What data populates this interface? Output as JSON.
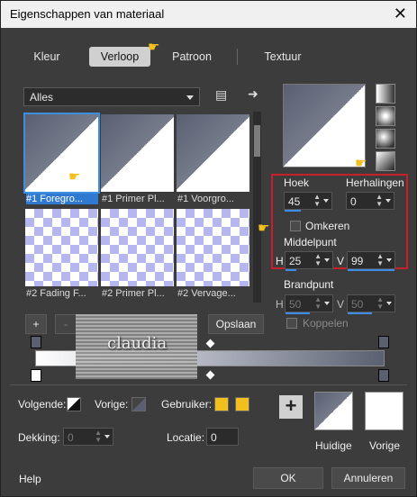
{
  "window": {
    "title": "Eigenschappen van materiaal",
    "close_glyph": "✕"
  },
  "tabs": [
    {
      "label": "Kleur"
    },
    {
      "label": "Verloop",
      "active": true
    },
    {
      "label": "Patroon"
    },
    {
      "label": "Textuur"
    }
  ],
  "category": {
    "selected": "Alles"
  },
  "thumbnails": [
    {
      "label": "#1 Foregro...",
      "style": "corner",
      "selected": true
    },
    {
      "label": "#1 Primer Pl...",
      "style": "corner"
    },
    {
      "label": "#1 Voorgro...",
      "style": "corner"
    },
    {
      "label": "#2 Fading F...",
      "style": "checker"
    },
    {
      "label": "#2 Primer Pl...",
      "style": "checker"
    },
    {
      "label": "#2 Vervage...",
      "style": "checker"
    }
  ],
  "gradient_settings": {
    "angle_label": "Hoek",
    "angle_value": "45",
    "repeats_label": "Herhalingen",
    "repeats_value": "0",
    "invert_label": "Omkeren",
    "center_label": "Middelpunt",
    "h_label": "H",
    "h_value": "25",
    "v_label": "V",
    "v_value": "99",
    "focal_label": "Brandpunt",
    "focal_h_value": "50",
    "focal_v_value": "50",
    "link_label": "Koppelen"
  },
  "editor": {
    "add_label": "+",
    "remove_label": "-",
    "save_label": "Opslaan",
    "watermark_text": "claudia"
  },
  "bottom": {
    "next_label": "Volgende:",
    "prev_label": "Vorige:",
    "user_label": "Gebruiker:",
    "user_color_1": "#f2c01e",
    "user_color_2": "#f2c01e",
    "opacity_label": "Dekking:",
    "opacity_value": "0",
    "location_label": "Locatie:",
    "location_value": "0",
    "plus_label": "+",
    "current_label": "Huidige",
    "previous_label": "Vorige"
  },
  "footer": {
    "help_label": "Help",
    "ok_label": "OK",
    "cancel_label": "Annuleren"
  },
  "colors": {
    "accent": "#3d8ee6",
    "highlight_box": "#c8202a",
    "gradient_dark": "#5a6071"
  }
}
